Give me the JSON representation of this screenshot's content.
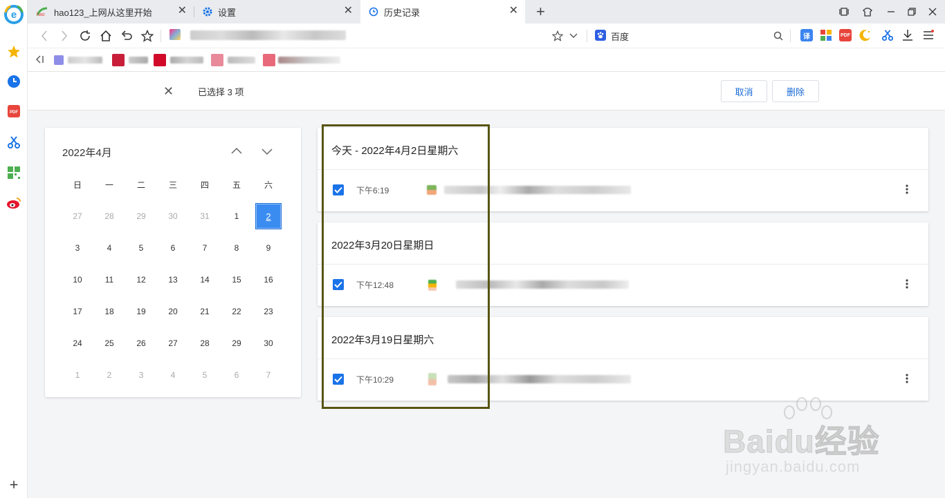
{
  "tabs": [
    {
      "title": "hao123_上网从这里开始",
      "icon": "hao123-icon",
      "active": false
    },
    {
      "title": "设置",
      "icon": "gear-icon",
      "active": false
    },
    {
      "title": "历史记录",
      "icon": "history-icon",
      "active": true
    }
  ],
  "new_tab_label": "+",
  "address_bar": {
    "search_engine_label": "百度"
  },
  "selection_bar": {
    "count_text": "已选择 3 项",
    "cancel_label": "取消",
    "delete_label": "删除"
  },
  "calendar": {
    "title": "2022年4月",
    "weekdays": [
      "日",
      "一",
      "二",
      "三",
      "四",
      "五",
      "六"
    ],
    "weeks": [
      [
        "27",
        "28",
        "29",
        "30",
        "31",
        "1",
        "2"
      ],
      [
        "3",
        "4",
        "5",
        "6",
        "7",
        "8",
        "9"
      ],
      [
        "10",
        "11",
        "12",
        "13",
        "14",
        "15",
        "16"
      ],
      [
        "17",
        "18",
        "19",
        "20",
        "21",
        "22",
        "23"
      ],
      [
        "24",
        "25",
        "26",
        "27",
        "28",
        "29",
        "30"
      ],
      [
        "1",
        "2",
        "3",
        "4",
        "5",
        "6",
        "7"
      ]
    ],
    "selected_day": "2"
  },
  "history_groups": [
    {
      "title": "今天 - 2022年4月2日星期六",
      "entries": [
        {
          "time": "下午6:19",
          "checked": true
        }
      ]
    },
    {
      "title": "2022年3月20日星期日",
      "entries": [
        {
          "time": "下午12:48",
          "checked": true
        }
      ]
    },
    {
      "title": "2022年3月19日星期六",
      "entries": [
        {
          "time": "下午10:29",
          "checked": true
        }
      ]
    }
  ],
  "watermark": {
    "main": "Baidu经验",
    "sub": "jingyan.baidu.com"
  },
  "colors": {
    "accent": "#1a73e8",
    "highlight_box": "#575412",
    "link_blue": "#1a6cd8"
  }
}
